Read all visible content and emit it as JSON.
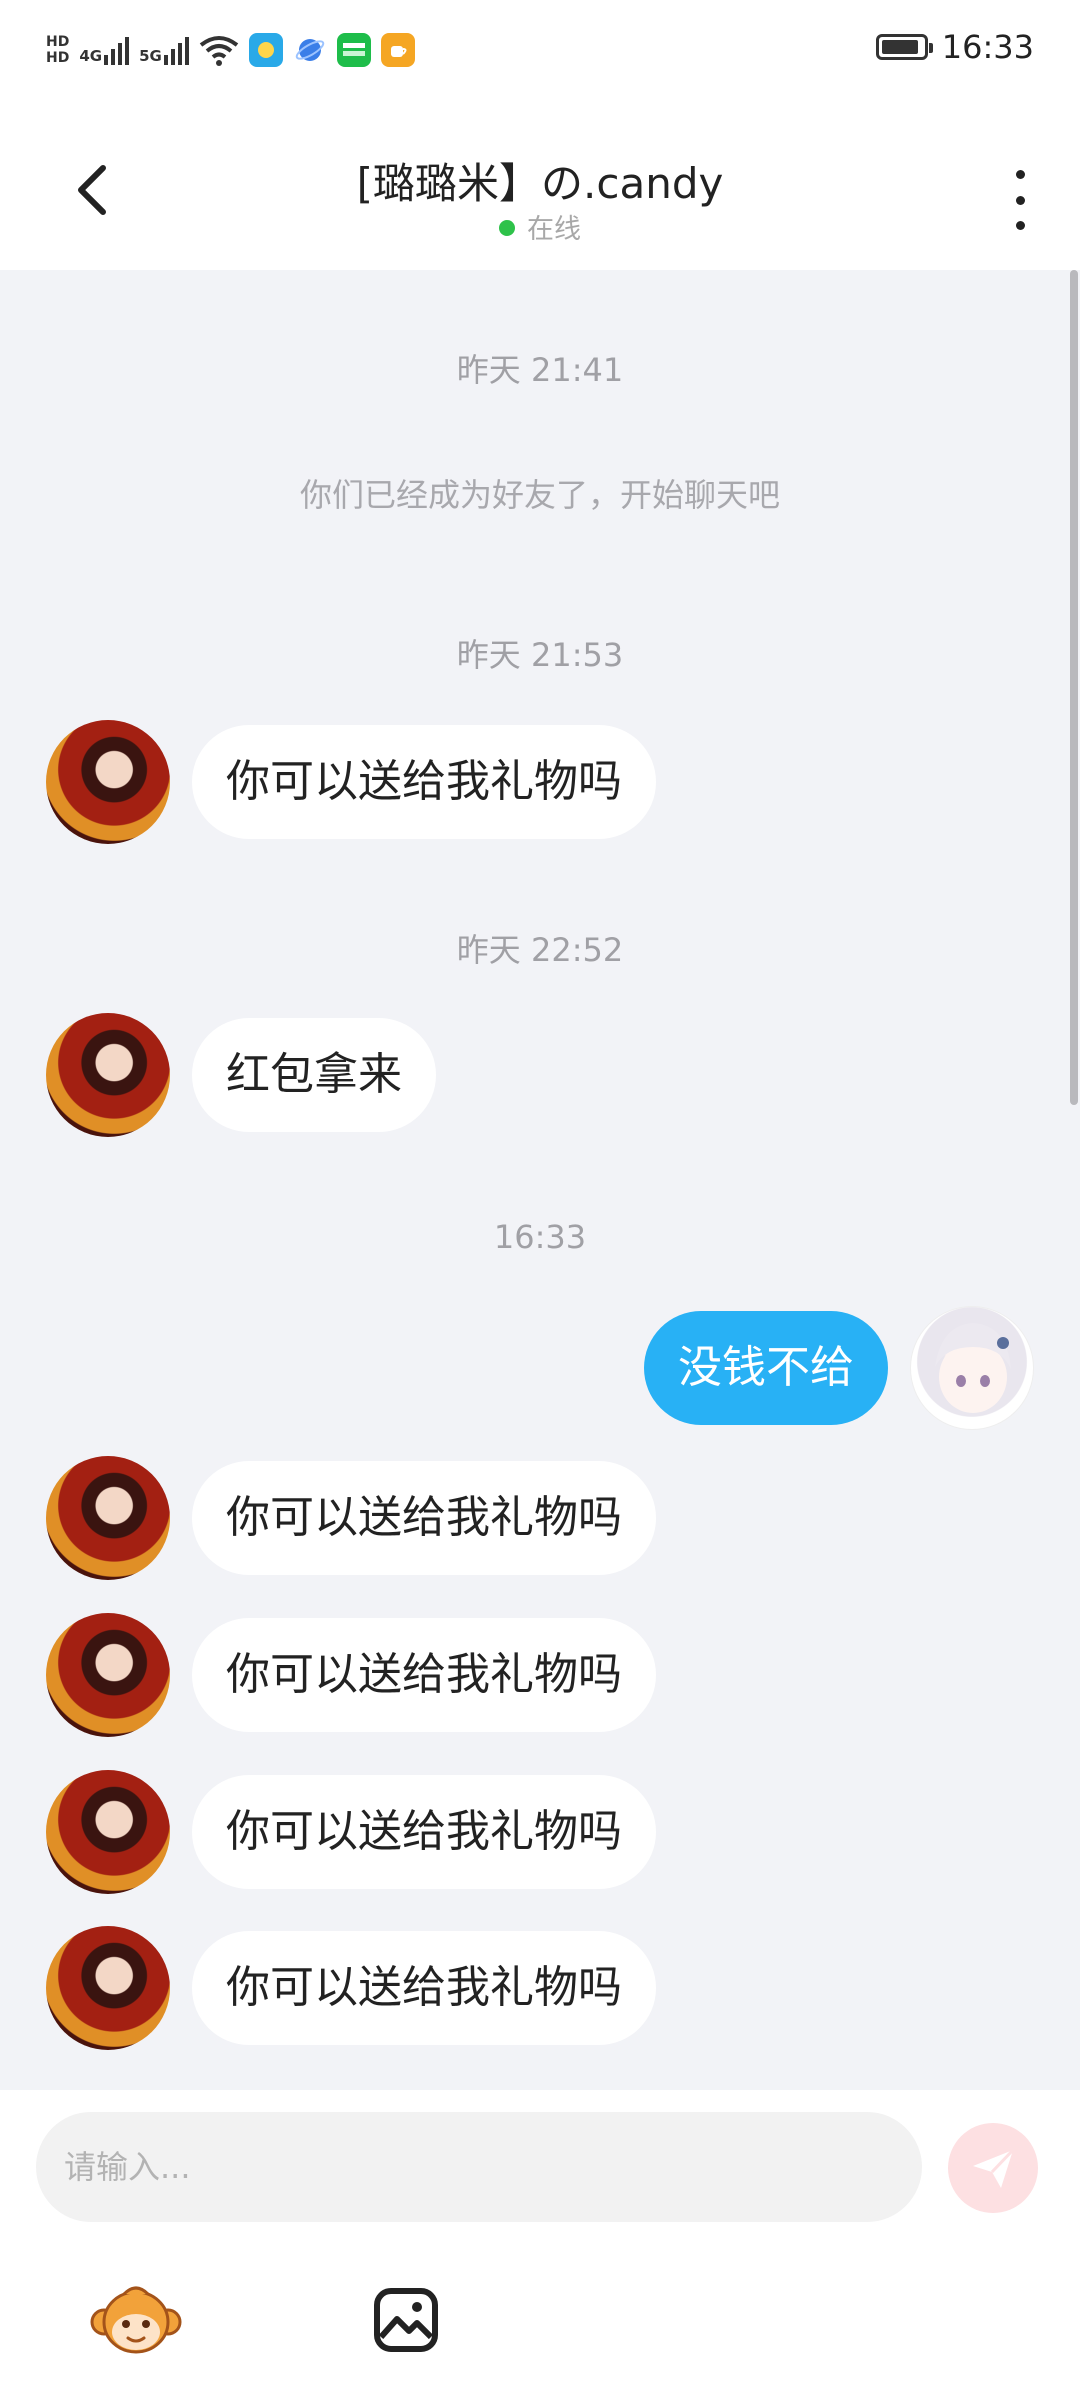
{
  "status_bar": {
    "hd_top": "HD",
    "hd_bottom": "HD",
    "net1": "4G",
    "net2": "5G",
    "time": "16:33",
    "icons": [
      "wifi-icon",
      "weather-app-icon",
      "browser-app-icon",
      "iqiyi-app-icon",
      "cup-app-icon"
    ],
    "battery_level": 0.9
  },
  "header": {
    "title": "[璐璐米】の.candy",
    "status": "在线",
    "status_color": "#2ec24a"
  },
  "chat": {
    "timestamps": [
      "昨天 21:41",
      "昨天 21:53",
      "昨天 22:52",
      "16:33"
    ],
    "system_message": "你们已经成为好友了，开始聊天吧",
    "messages": [
      {
        "side": "in",
        "text": "你可以送给我礼物吗"
      },
      {
        "side": "in",
        "text": "红包拿来"
      },
      {
        "side": "out",
        "text": "没钱不给"
      },
      {
        "side": "in",
        "text": "你可以送给我礼物吗"
      },
      {
        "side": "in",
        "text": "你可以送给我礼物吗"
      },
      {
        "side": "in",
        "text": "你可以送给我礼物吗"
      },
      {
        "side": "in",
        "text": "你可以送给我礼物吗"
      }
    ]
  },
  "composer": {
    "placeholder": "请输入...",
    "value": ""
  },
  "colors": {
    "accent_bubble": "#28b1f5",
    "chat_background": "#f2f3f7",
    "send_button": "#fde0e2"
  }
}
